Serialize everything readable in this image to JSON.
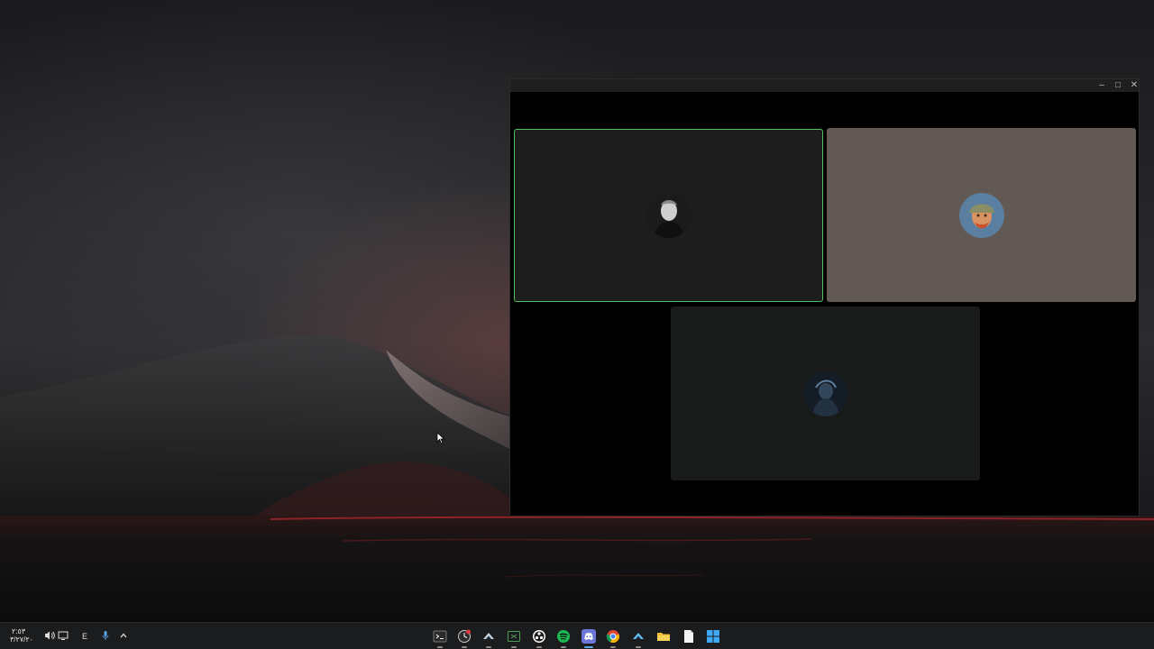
{
  "window": {
    "controls": {
      "minimize": "–",
      "maximize": "□",
      "close": "✕"
    },
    "participants": [
      {
        "avatar": "man-portrait-avatar",
        "speaking": true
      },
      {
        "avatar": "van-gogh-portrait-avatar",
        "speaking": false
      },
      {
        "avatar": "dark-figure-avatar",
        "speaking": false
      }
    ],
    "colors": {
      "speaking_border": "#4fbf5a",
      "tile_2_bg": "#625955"
    }
  },
  "taskbar": {
    "clock": {
      "time": "٢:٥٣",
      "date": "٣/٢٧/٢٠"
    },
    "language": "E",
    "tray_icons": [
      "volume-icon",
      "display-icon",
      "microphone-icon",
      "chevron-up-icon"
    ],
    "apps": [
      "terminal",
      "clock-app",
      "steam",
      "xbox-app",
      "obs",
      "spotify",
      "discord",
      "chrome",
      "steam-2",
      "file-explorer",
      "notepad",
      "windows-start"
    ]
  }
}
